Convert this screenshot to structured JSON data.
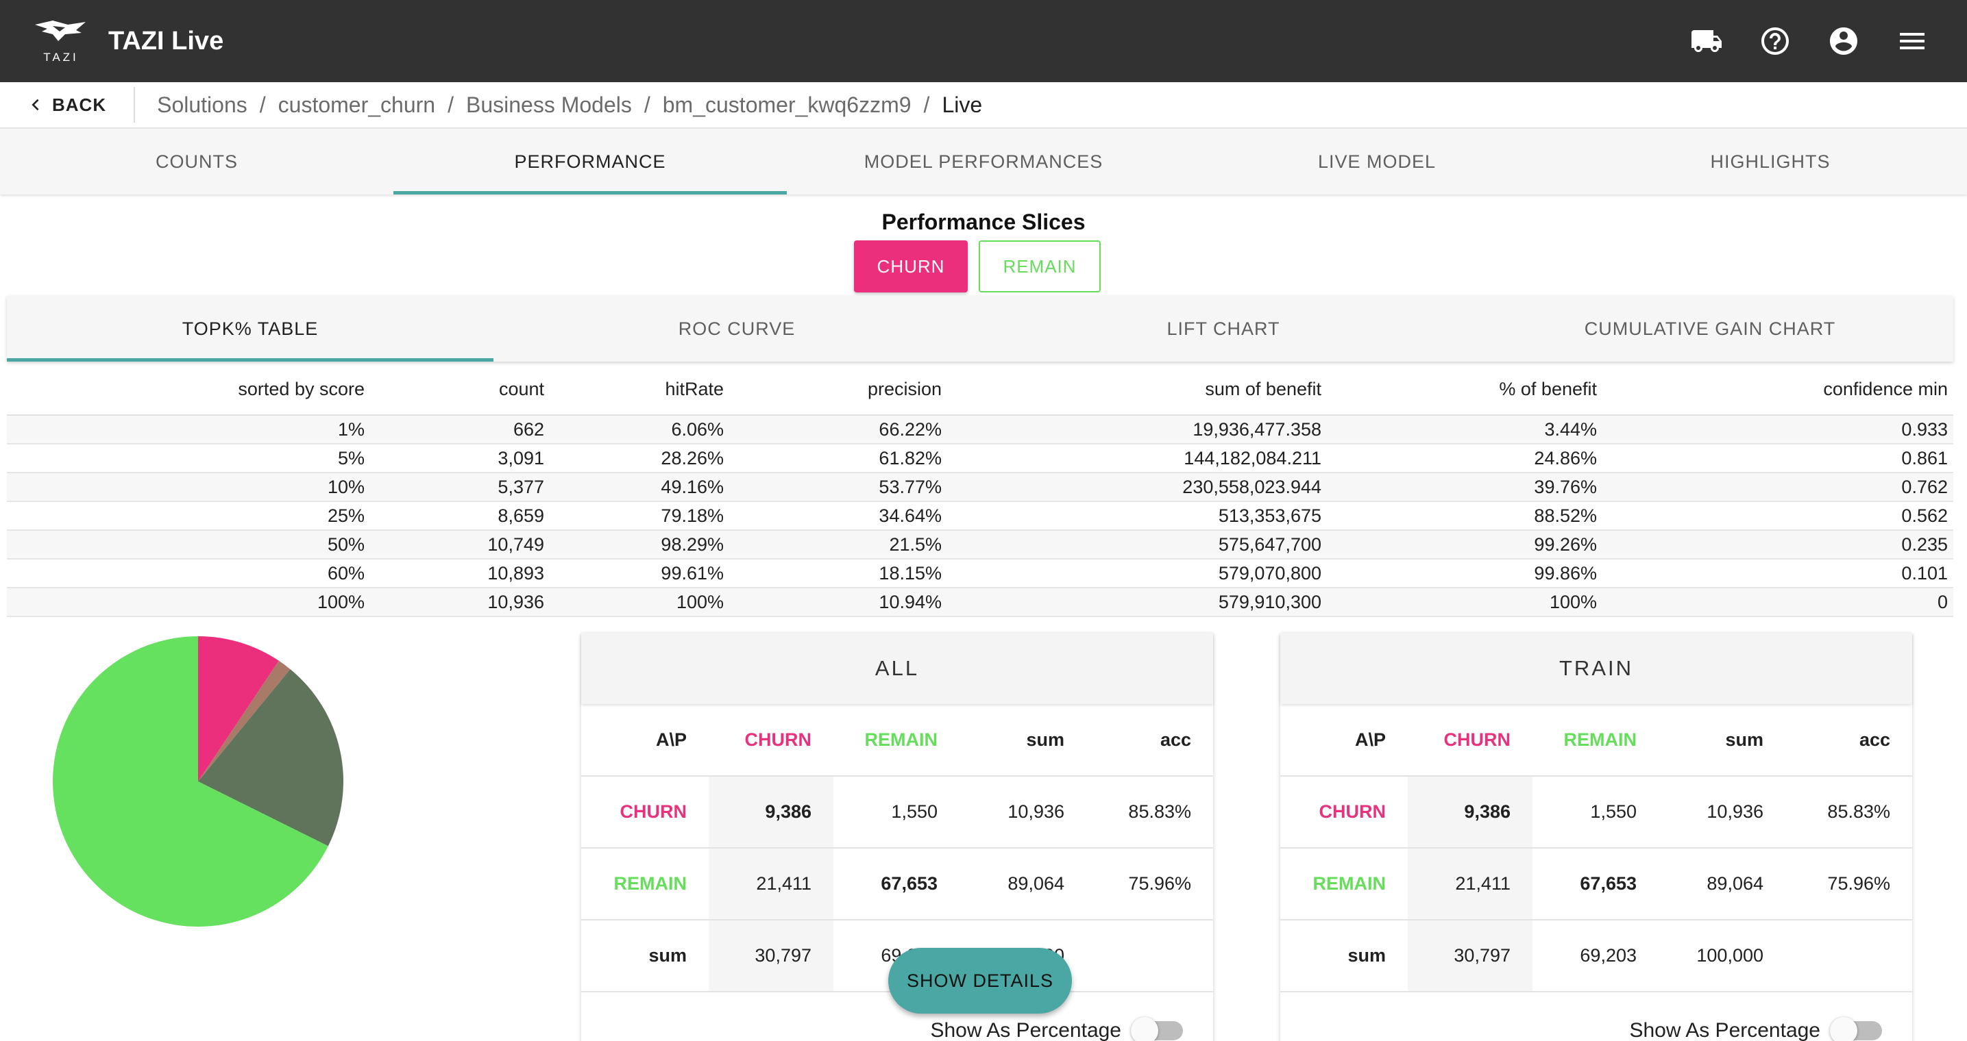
{
  "app": {
    "title": "TAZI Live",
    "logo_text": "TAZI"
  },
  "header_icons": [
    "truck-icon",
    "help-icon",
    "account-icon",
    "menu-icon"
  ],
  "nav": {
    "back_label": "BACK",
    "breadcrumb": [
      "Solutions",
      "customer_churn",
      "Business Models",
      "bm_customer_kwq6zzm9",
      "Live"
    ]
  },
  "main_tabs": [
    "COUNTS",
    "PERFORMANCE",
    "MODEL PERFORMANCES",
    "LIVE MODEL",
    "HIGHLIGHTS"
  ],
  "main_tab_active": "PERFORMANCE",
  "slices": {
    "title": "Performance Slices",
    "options": [
      "CHURN",
      "REMAIN"
    ],
    "selected": "CHURN"
  },
  "sub_tabs": [
    "TOPK% TABLE",
    "ROC CURVE",
    "LIFT CHART",
    "CUMULATIVE GAIN CHART"
  ],
  "sub_tab_active": "TOPK% TABLE",
  "topk_table": {
    "headers": [
      "sorted by score",
      "count",
      "hitRate",
      "precision",
      "sum of benefit",
      "% of benefit",
      "confidence min"
    ],
    "rows": [
      [
        "1%",
        "662",
        "6.06%",
        "66.22%",
        "19,936,477.358",
        "3.44%",
        "0.933"
      ],
      [
        "5%",
        "3,091",
        "28.26%",
        "61.82%",
        "144,182,084.211",
        "24.86%",
        "0.861"
      ],
      [
        "10%",
        "5,377",
        "49.16%",
        "53.77%",
        "230,558,023.944",
        "39.76%",
        "0.762"
      ],
      [
        "25%",
        "8,659",
        "79.18%",
        "34.64%",
        "513,353,675",
        "88.52%",
        "0.562"
      ],
      [
        "50%",
        "10,749",
        "98.29%",
        "21.5%",
        "575,647,700",
        "99.26%",
        "0.235"
      ],
      [
        "60%",
        "10,893",
        "99.61%",
        "18.15%",
        "579,070,800",
        "99.86%",
        "0.101"
      ],
      [
        "100%",
        "10,936",
        "100%",
        "10.94%",
        "579,910,300",
        "100%",
        "0"
      ]
    ]
  },
  "chart_data": {
    "type": "pie",
    "slices": [
      {
        "value": 9386,
        "color": "#ec2f7c"
      },
      {
        "value": 1550,
        "color": "#a97a68"
      },
      {
        "value": 21411,
        "color": "#5f745b"
      },
      {
        "value": 67653,
        "color": "#66e05f"
      }
    ]
  },
  "confusion": {
    "cards": [
      {
        "title": "ALL",
        "header": [
          "A\\P",
          "CHURN",
          "REMAIN",
          "sum",
          "acc"
        ],
        "rows": [
          [
            "CHURN",
            "9,386",
            "1,550",
            "10,936",
            "85.83%"
          ],
          [
            "REMAIN",
            "21,411",
            "67,653",
            "89,064",
            "75.96%"
          ],
          [
            "sum",
            "30,797",
            "69,203",
            "100,000",
            ""
          ]
        ],
        "percentage_label": "Show As Percentage"
      },
      {
        "title": "TRAIN",
        "header": [
          "A\\P",
          "CHURN",
          "REMAIN",
          "sum",
          "acc"
        ],
        "rows": [
          [
            "CHURN",
            "9,386",
            "1,550",
            "10,936",
            "85.83%"
          ],
          [
            "REMAIN",
            "21,411",
            "67,653",
            "89,064",
            "75.96%"
          ],
          [
            "sum",
            "30,797",
            "69,203",
            "100,000",
            ""
          ]
        ],
        "percentage_label": "Show As Percentage"
      }
    ]
  },
  "fab": {
    "label": "SHOW DETAILS"
  },
  "colors": {
    "churn": "#ec2f7c",
    "remain": "#66de5c",
    "accent": "#4ba7a3",
    "appbar": "#323232"
  }
}
